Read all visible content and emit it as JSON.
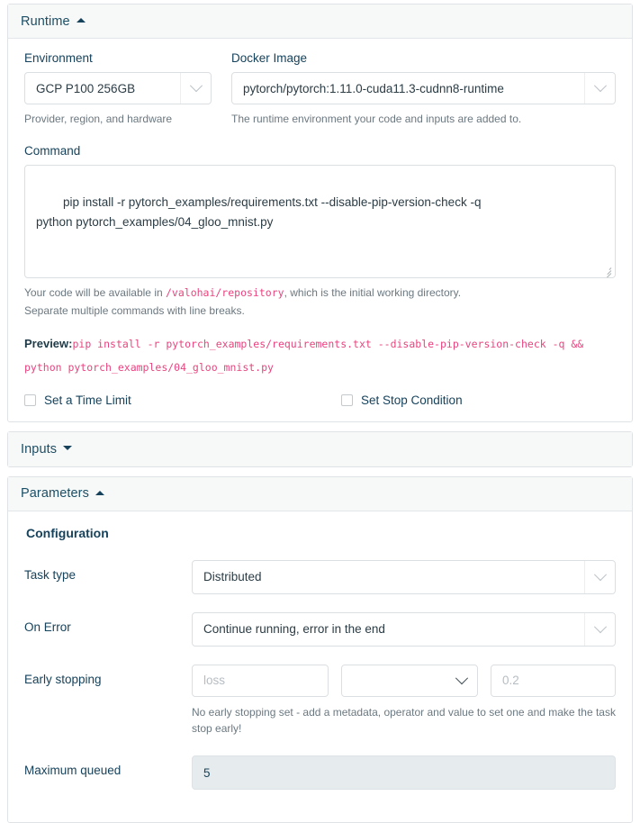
{
  "runtime": {
    "title": "Runtime",
    "caret": "caret-up-icon",
    "environment": {
      "label": "Environment",
      "value": "GCP P100 256GB",
      "hint": "Provider, region, and hardware"
    },
    "docker_image": {
      "label": "Docker Image",
      "value": "pytorch/pytorch:1.11.0-cuda11.3-cudnn8-runtime",
      "hint": "The runtime environment your code and inputs are added to."
    },
    "command": {
      "label": "Command",
      "value": "pip install -r pytorch_examples/requirements.txt --disable-pip-version-check -q\npython pytorch_examples/04_gloo_mnist.py",
      "hint_before": "Your code will be available in ",
      "hint_code": "/valohai/repository",
      "hint_after": ", which is the initial working directory.",
      "hint_line2": "Separate multiple commands with line breaks."
    },
    "preview": {
      "label": "Preview:",
      "value": "pip install -r pytorch_examples/requirements.txt --disable-pip-version-check -q && python pytorch_examples/04_gloo_mnist.py"
    },
    "checkboxes": [
      {
        "label": "Set a Time Limit",
        "checked": false
      },
      {
        "label": "Set Stop Condition",
        "checked": false
      }
    ]
  },
  "inputs": {
    "title": "Inputs",
    "caret": "caret-down-icon"
  },
  "parameters": {
    "title": "Parameters",
    "caret": "caret-up-icon",
    "section_title": "Configuration",
    "task_type": {
      "label": "Task type",
      "value": "Distributed"
    },
    "on_error": {
      "label": "On Error",
      "value": "Continue running, error in the end"
    },
    "early_stopping": {
      "label": "Early stopping",
      "metadata_placeholder": "loss",
      "operator_value": "",
      "threshold_placeholder": "0.2",
      "hint": "No early stopping set - add a metadata, operator and value to set one and make the task stop early!"
    },
    "maximum_queued": {
      "label": "Maximum queued",
      "value": "5"
    }
  },
  "colors": {
    "accent_pink": "#e8447f",
    "label_blue": "#16425b",
    "panel_header_bg": "#f7f8f8",
    "border": "#dfe3e6",
    "disabled_bg": "#e6ebee"
  }
}
